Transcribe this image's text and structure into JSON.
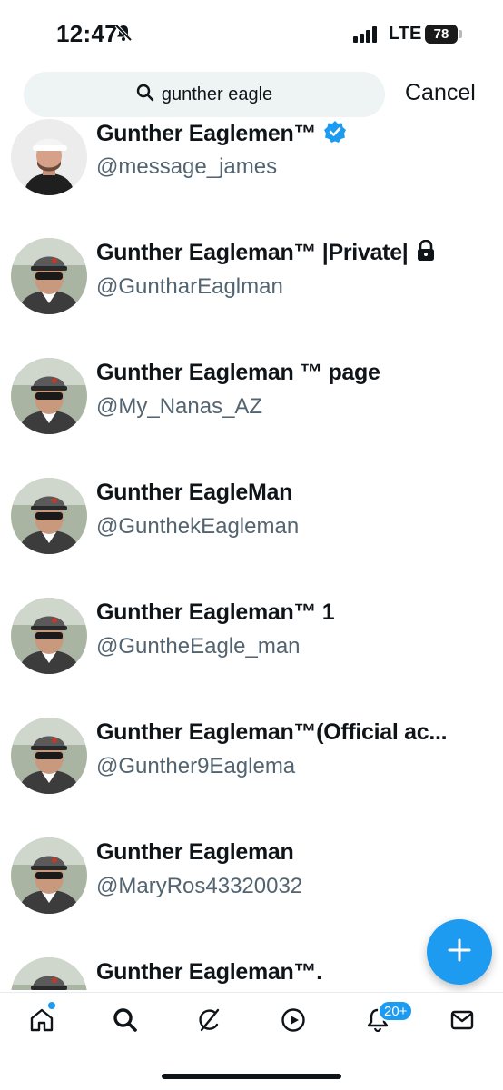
{
  "status_bar": {
    "time": "12:47",
    "network": "LTE",
    "battery": "78"
  },
  "search": {
    "query": "gunther eagle",
    "cancel_label": "Cancel"
  },
  "results": [
    {
      "name": "Gunther Eaglemen™",
      "handle": "@message_james",
      "verified": true,
      "locked": false
    },
    {
      "name": "Gunther Eagleman™ |Private|",
      "handle": "@GuntharEaglman",
      "verified": false,
      "locked": true
    },
    {
      "name": "Gunther Eagleman ™ page",
      "handle": "@My_Nanas_AZ",
      "verified": false,
      "locked": false
    },
    {
      "name": "Gunther EagleMan",
      "handle": "@GunthekEagleman",
      "verified": false,
      "locked": false
    },
    {
      "name": "Gunther Eagleman™ 1",
      "handle": "@GuntheEagle_man",
      "verified": false,
      "locked": false
    },
    {
      "name": "Gunther Eagleman™(Official ac...",
      "handle": "@Gunther9Eaglema",
      "verified": false,
      "locked": false
    },
    {
      "name": "Gunther Eagleman",
      "handle": "@MaryRos43320032",
      "verified": false,
      "locked": false
    },
    {
      "name": "Gunther Eagleman™.",
      "handle": "",
      "verified": false,
      "locked": false
    }
  ],
  "tabbar": {
    "tabs": [
      "home-icon",
      "search-icon",
      "grok-icon",
      "video-icon",
      "notifications-icon",
      "messages-icon"
    ],
    "notifications_badge": "20+"
  },
  "colors": {
    "accent": "#1d9bf0",
    "secondary_text": "#536471",
    "search_bg": "#eef3f4"
  }
}
